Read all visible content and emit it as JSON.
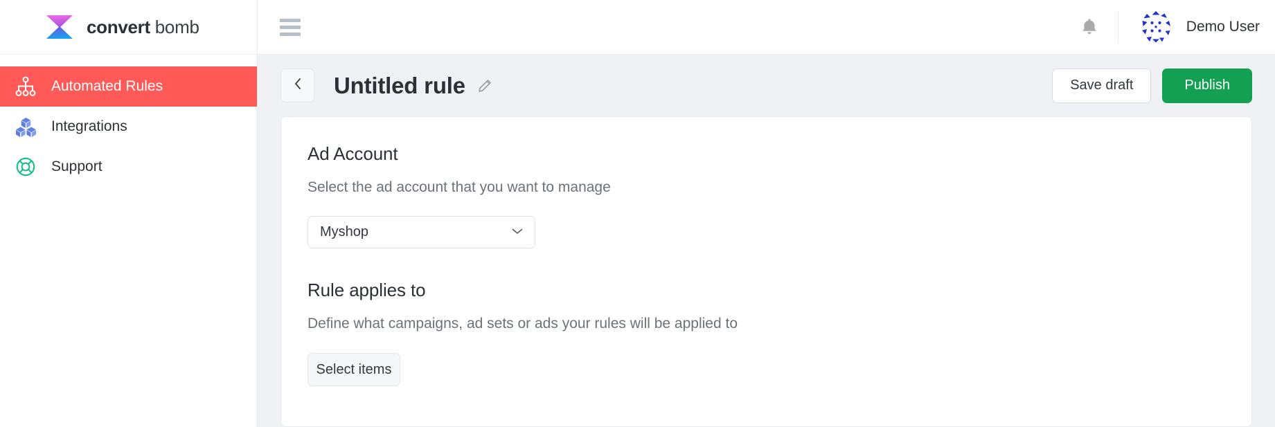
{
  "brand": {
    "name_bold": "convert",
    "name_light": "bomb",
    "logo_icon": "hourglass-logo"
  },
  "sidebar": {
    "items": [
      {
        "label": "Automated Rules",
        "icon": "sitemap-icon",
        "active": true
      },
      {
        "label": "Integrations",
        "icon": "cubes-icon",
        "active": false
      },
      {
        "label": "Support",
        "icon": "life-ring-icon",
        "active": false
      }
    ]
  },
  "topbar": {
    "menu_icon": "hamburger-icon",
    "notification_icon": "bell-icon",
    "avatar_icon": "user-avatar-identicon",
    "user_name": "Demo User"
  },
  "page_header": {
    "back_icon": "chevron-left-icon",
    "title": "Untitled rule",
    "edit_icon": "pencil-icon",
    "save_draft_label": "Save draft",
    "publish_label": "Publish"
  },
  "main": {
    "ad_account": {
      "title": "Ad Account",
      "description": "Select the ad account that you want to manage",
      "select_value": "Myshop",
      "select_caret_icon": "chevron-down-icon"
    },
    "rule_applies_to": {
      "title": "Rule applies to",
      "description": "Define what campaigns, ad sets or ads your rules will be applied to",
      "select_items_label": "Select items"
    }
  },
  "colors": {
    "active_nav": "#ff5a57",
    "publish_green": "#14a053",
    "page_bg": "#eff1f4",
    "integrations_icon": "#5b7ce0",
    "support_icon": "#19bd8c",
    "avatar_blue": "#2233cc"
  }
}
